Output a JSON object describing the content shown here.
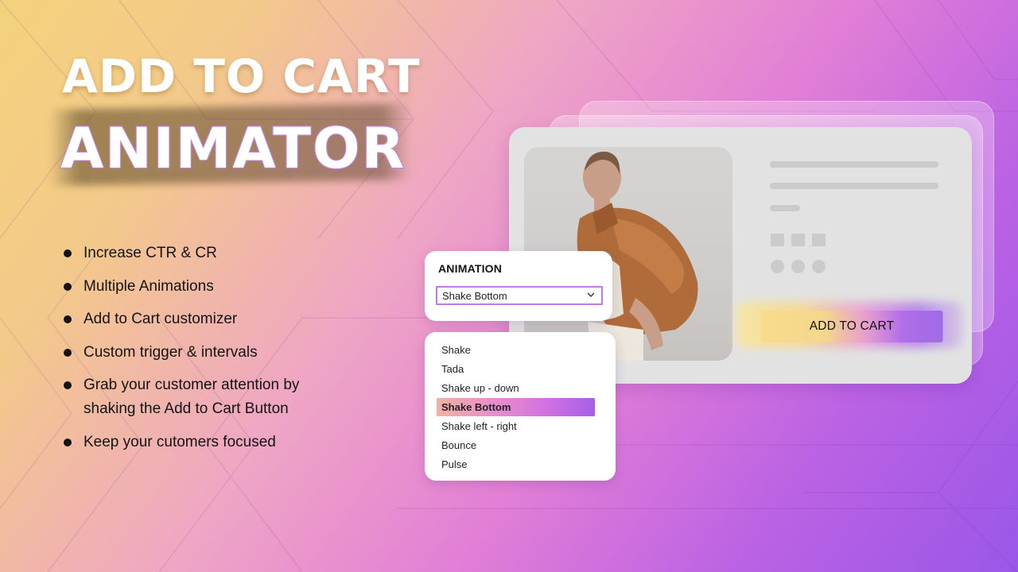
{
  "hero": {
    "title_line1": "ADD TO CART",
    "title_line2": "ANIMATOR"
  },
  "features": [
    "Increase CTR & CR",
    "Multiple Animations",
    "Add to Cart customizer",
    "Custom trigger & intervals",
    "Grab your customer attention by shaking the Add to Cart Button",
    "Keep your cutomers focused"
  ],
  "animation_panel": {
    "label": "ANIMATION",
    "selected_value": "Shake Bottom",
    "chevron_icon": "chevron-down-icon"
  },
  "animation_options": [
    {
      "label": "Shake",
      "selected": false
    },
    {
      "label": "Tada",
      "selected": false
    },
    {
      "label": "Shake up - down",
      "selected": false
    },
    {
      "label": "Shake Bottom",
      "selected": true
    },
    {
      "label": "Shake left - right",
      "selected": false
    },
    {
      "label": "Bounce",
      "selected": false
    },
    {
      "label": "Pulse",
      "selected": false
    }
  ],
  "product_card": {
    "image": "model-in-brown-leather-jacket-photo",
    "add_to_cart_label": "ADD TO CART"
  },
  "colors": {
    "bg_start": "#f4d27c",
    "bg_mid": "#e27fd6",
    "bg_end": "#9a57e8",
    "select_border": "#b57ee0",
    "card_bg": "#e2e2e2",
    "skeleton": "#cbcbcb"
  }
}
